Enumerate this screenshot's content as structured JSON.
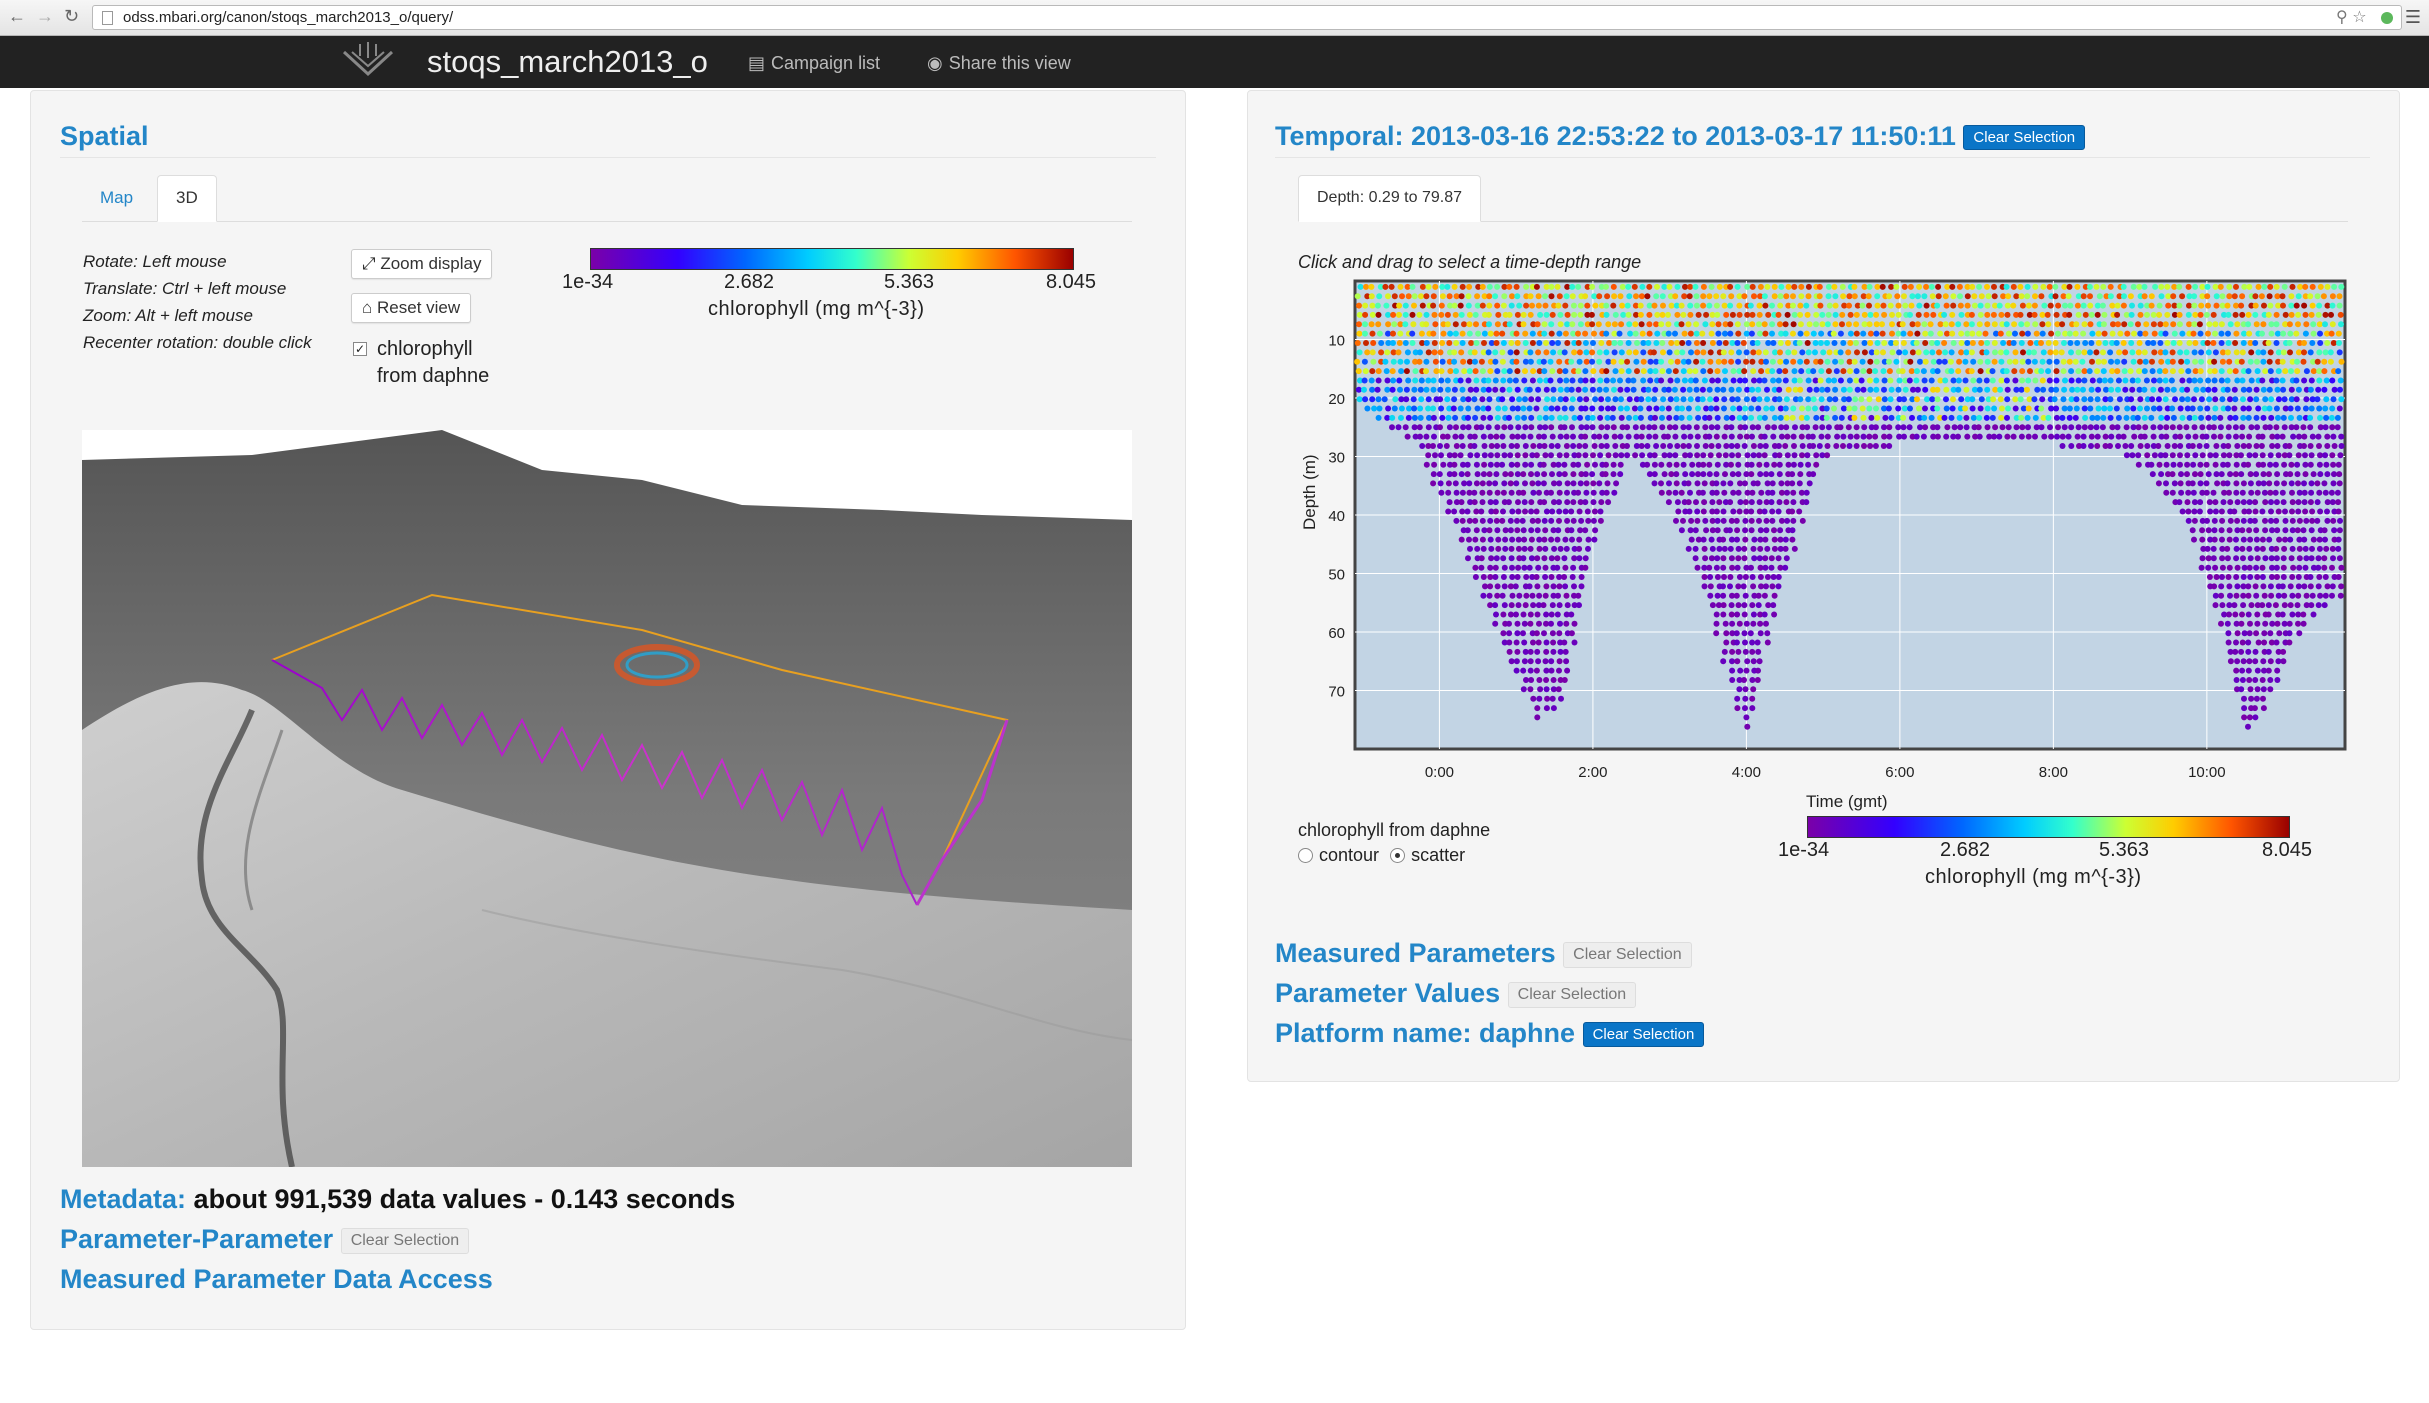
{
  "browser": {
    "url": "odss.mbari.org/canon/stoqs_march2013_o/query/"
  },
  "navbar": {
    "brand": "stoqs_march2013_o",
    "campaign_list": "Campaign list",
    "share_view": "Share this view"
  },
  "spatial": {
    "title": "Spatial",
    "tabs": [
      {
        "label": "Map",
        "active": false
      },
      {
        "label": "3D",
        "active": true
      }
    ],
    "help": [
      "Rotate: Left mouse",
      "Translate: Ctrl + left mouse",
      "Zoom: Alt + left mouse",
      "Recenter rotation: double click"
    ],
    "zoom_display": "Zoom display",
    "reset_view": "Reset view",
    "checkbox_line1": "chlorophyll",
    "checkbox_line2": "from daphne",
    "checkbox_checked": true,
    "colorbar": {
      "ticks": [
        "1e-34",
        "2.682",
        "5.363",
        "8.045"
      ],
      "label": "chlorophyll (mg m^{-3})"
    }
  },
  "metadata": {
    "label": "Metadata:",
    "value": "about 991,539 data values - 0.143 seconds"
  },
  "parameter_parameter": {
    "title": "Parameter-Parameter",
    "clear": "Clear Selection"
  },
  "measured_data_access": {
    "title": "Measured Parameter Data Access"
  },
  "temporal": {
    "title": "Temporal: 2013-03-16 22:53:22 to 2013-03-17 11:50:11",
    "clear": "Clear Selection",
    "tab": "Depth: 0.29 to 79.87",
    "hint": "Click and drag to select a time-depth range",
    "plot_title": "Time (gmt)",
    "ylabel": "Depth (m)",
    "legend_title": "chlorophyll from daphne",
    "radio_contour": "contour",
    "radio_scatter": "scatter",
    "selected_mode": "scatter",
    "colorbar": {
      "ticks": [
        "1e-34",
        "2.682",
        "5.363",
        "8.045"
      ],
      "label": "chlorophyll (mg m^{-3})"
    }
  },
  "chart_data": {
    "type": "scatter",
    "xlabel": "Time (gmt)",
    "ylabel": "Depth (m)",
    "x_ticks": [
      "0:00",
      "2:00",
      "4:00",
      "6:00",
      "8:00",
      "10:00"
    ],
    "y_ticks": [
      10,
      20,
      30,
      40,
      50,
      60,
      70
    ],
    "x_range_hours": [
      -1.1,
      11.8
    ],
    "y_range": [
      0,
      80
    ],
    "colorscale": {
      "min": 1e-34,
      "max": 8.045
    },
    "yo_profile_max_depth": [
      {
        "t": -1.0,
        "depth": 22
      },
      {
        "t": -0.3,
        "depth": 28
      },
      {
        "t": 0.3,
        "depth": 45
      },
      {
        "t": 0.9,
        "depth": 65
      },
      {
        "t": 1.3,
        "depth": 75
      },
      {
        "t": 1.6,
        "depth": 72
      },
      {
        "t": 2.0,
        "depth": 45
      },
      {
        "t": 2.5,
        "depth": 30
      },
      {
        "t": 3.0,
        "depth": 38
      },
      {
        "t": 3.5,
        "depth": 55
      },
      {
        "t": 4.0,
        "depth": 78
      },
      {
        "t": 4.4,
        "depth": 55
      },
      {
        "t": 5.0,
        "depth": 30
      },
      {
        "t": 6.0,
        "depth": 28
      },
      {
        "t": 7.0,
        "depth": 27
      },
      {
        "t": 8.0,
        "depth": 28
      },
      {
        "t": 9.0,
        "depth": 30
      },
      {
        "t": 9.7,
        "depth": 40
      },
      {
        "t": 10.2,
        "depth": 60
      },
      {
        "t": 10.5,
        "depth": 78
      },
      {
        "t": 10.8,
        "depth": 72
      },
      {
        "t": 11.2,
        "depth": 60
      },
      {
        "t": 11.6,
        "depth": 55
      }
    ]
  },
  "measured_parameters": {
    "title": "Measured Parameters",
    "clear": "Clear Selection"
  },
  "parameter_values": {
    "title": "Parameter Values",
    "clear": "Clear Selection"
  },
  "platform": {
    "title": "Platform name: daphne",
    "clear": "Clear Selection"
  }
}
